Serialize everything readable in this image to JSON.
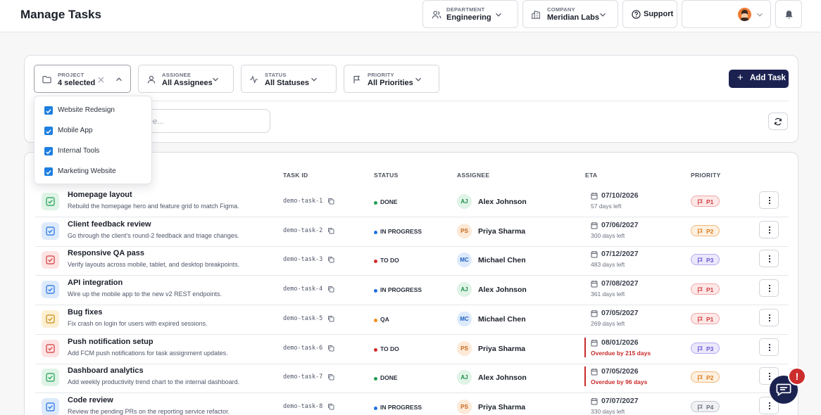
{
  "header": {
    "title": "Manage Tasks",
    "department": {
      "label": "DEPARTMENT",
      "value": "Engineering"
    },
    "company": {
      "label": "COMPANY",
      "value": "Meridian Labs"
    },
    "support_label": "Support"
  },
  "filters": {
    "project": {
      "label": "PROJECT",
      "value": "4 selected"
    },
    "assignee": {
      "label": "ASSIGNEE",
      "value": "All Assignees"
    },
    "status": {
      "label": "STATUS",
      "value": "All Statuses"
    },
    "priority": {
      "label": "PRIORITY",
      "value": "All Priorities"
    },
    "add_task_label": "Add Task",
    "search_placeholder_visible": "ee..."
  },
  "project_dropdown": {
    "items": [
      {
        "label": "Website Redesign",
        "checked": true
      },
      {
        "label": "Mobile App",
        "checked": true
      },
      {
        "label": "Internal Tools",
        "checked": true
      },
      {
        "label": "Marketing Website",
        "checked": true
      }
    ]
  },
  "table": {
    "columns": {
      "task_id": "TASK ID",
      "status": "STATUS",
      "assignee": "ASSIGNEE",
      "eta": "ETA",
      "priority": "PRIORITY"
    },
    "rows": [
      {
        "title": "Homepage layout",
        "desc": "Rebuild the homepage hero and feature grid to match Figma.",
        "id": "demo-task-1",
        "status": "DONE",
        "initials": "AJ",
        "assignee": "Alex Johnson",
        "date": "07/10/2026",
        "days": "57 days left",
        "overdue": false,
        "priority": "P1"
      },
      {
        "title": "Client feedback review",
        "desc": "Go through the client's round-2 feedback and triage changes.",
        "id": "demo-task-2",
        "status": "IN PROGRESS",
        "initials": "PS",
        "assignee": "Priya Sharma",
        "date": "07/06/2027",
        "days": "300 days left",
        "overdue": false,
        "priority": "P2"
      },
      {
        "title": "Responsive QA pass",
        "desc": "Verify layouts across mobile, tablet, and desktop breakpoints.",
        "id": "demo-task-3",
        "status": "TO DO",
        "initials": "MC",
        "assignee": "Michael Chen",
        "date": "07/12/2027",
        "days": "483 days left",
        "overdue": false,
        "priority": "P3"
      },
      {
        "title": "API integration",
        "desc": "Wire up the mobile app to the new v2 REST endpoints.",
        "id": "demo-task-4",
        "status": "IN PROGRESS",
        "initials": "AJ",
        "assignee": "Alex Johnson",
        "date": "07/08/2027",
        "days": "361 days left",
        "overdue": false,
        "priority": "P1"
      },
      {
        "title": "Bug fixes",
        "desc": "Fix crash on login for users with expired sessions.",
        "id": "demo-task-5",
        "status": "QA",
        "initials": "MC",
        "assignee": "Michael Chen",
        "date": "07/05/2027",
        "days": "269 days left",
        "overdue": false,
        "priority": "P1"
      },
      {
        "title": "Push notification setup",
        "desc": "Add FCM push notifications for task assignment updates.",
        "id": "demo-task-6",
        "status": "TO DO",
        "initials": "PS",
        "assignee": "Priya Sharma",
        "date": "08/01/2026",
        "days": "Overdue by 215 days",
        "overdue": true,
        "priority": "P3"
      },
      {
        "title": "Dashboard analytics",
        "desc": "Add weekly productivity trend chart to the internal dashboard.",
        "id": "demo-task-7",
        "status": "DONE",
        "initials": "AJ",
        "assignee": "Alex Johnson",
        "date": "07/05/2026",
        "days": "Overdue by 96 days",
        "overdue": true,
        "priority": "P2"
      },
      {
        "title": "Code review",
        "desc": "Review the pending PRs on the reporting service refactor.",
        "id": "demo-task-8",
        "status": "IN PROGRESS",
        "initials": "PS",
        "assignee": "Priya Sharma",
        "date": "07/07/2027",
        "days": "330 days left",
        "overdue": false,
        "priority": "P4"
      }
    ]
  },
  "colors": {
    "brand": "#1b2250",
    "done": "#1e9e52",
    "in_progress": "#1e6fe0",
    "todo": "#d42b2b",
    "qa": "#f08c1a",
    "p1": "#d43a3a",
    "p2": "#e07a1a",
    "p3": "#6a55d8",
    "p4": "#6b7080"
  },
  "chat_badge": "!"
}
